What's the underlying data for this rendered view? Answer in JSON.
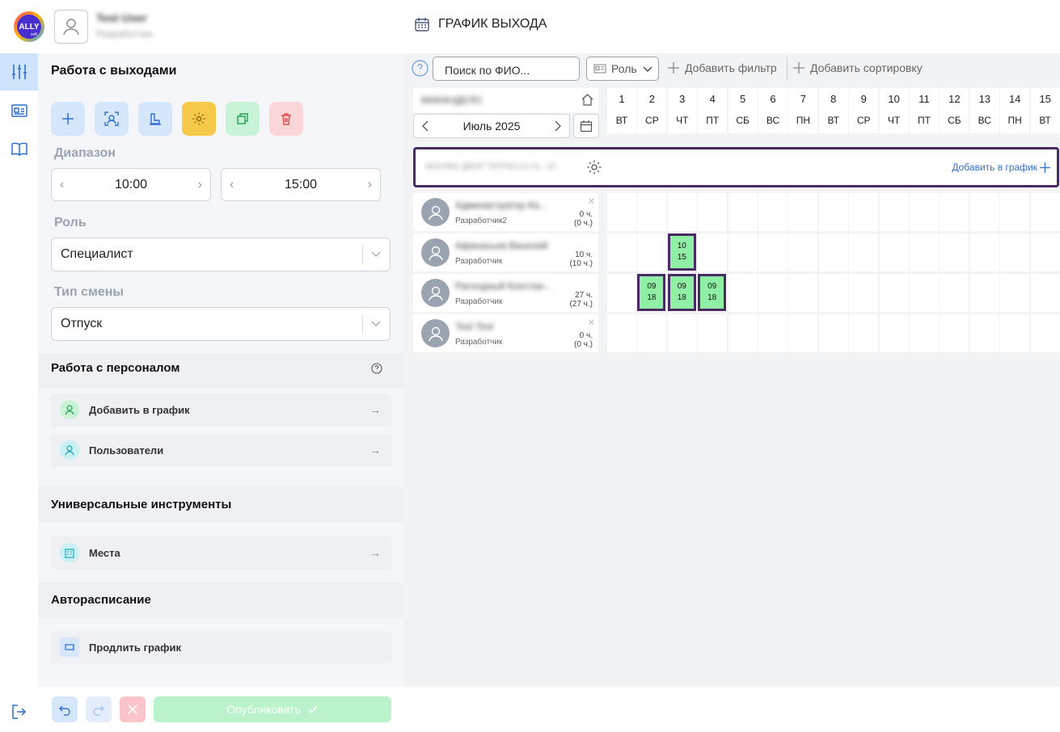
{
  "header": {
    "logo_text": "ALLY",
    "logo_sub": "soft",
    "user_name": "Test User",
    "user_subtitle": "Разработчик",
    "page_title": "ГРАФИК ВЫХОДА"
  },
  "panel": {
    "work_title": "Работа с выходами",
    "range_label": "Диапазон",
    "time_from": "10:00",
    "time_to": "15:00",
    "role_label": "Роль",
    "role_value": "Специалист",
    "shift_type_label": "Тип смены",
    "shift_type_value": "Отпуск",
    "staff_title": "Работа с персоналом",
    "add_to_schedule": "Добавить в график",
    "users": "Пользователи",
    "universal_title": "Универсальные инструменты",
    "places": "Места",
    "auto_title": "Авторасписание",
    "extend": "Продлить график"
  },
  "footer": {
    "publish": "Опубликовать"
  },
  "toolbar": {
    "search_placeholder": "Поиск по ФИО...",
    "role_filter": "Роль",
    "add_filter": "Добавить фильтр",
    "add_sort": "Добавить сортировку"
  },
  "calendar": {
    "company": "МАКАНДЕЛО",
    "month": "Июль 2025",
    "days": [
      {
        "n": "1",
        "w": "ВТ"
      },
      {
        "n": "2",
        "w": "СР"
      },
      {
        "n": "3",
        "w": "ЧТ"
      },
      {
        "n": "4",
        "w": "ПТ"
      },
      {
        "n": "5",
        "w": "СБ"
      },
      {
        "n": "6",
        "w": "ВС"
      },
      {
        "n": "7",
        "w": "ПН"
      },
      {
        "n": "8",
        "w": "ВТ"
      },
      {
        "n": "9",
        "w": "СР"
      },
      {
        "n": "10",
        "w": "ЧТ"
      },
      {
        "n": "11",
        "w": "ПТ"
      },
      {
        "n": "12",
        "w": "СБ"
      },
      {
        "n": "13",
        "w": "ВС"
      },
      {
        "n": "14",
        "w": "ПН"
      },
      {
        "n": "15",
        "w": "ВТ"
      }
    ],
    "group_name": "МОСКВА ДВОР ТЕРРАССА 01...10",
    "group_add": "Добавить в график"
  },
  "employees": [
    {
      "name": "Администратор Ка...",
      "role": "Разработчик2",
      "h1": "0 ч.",
      "h2": "(0 ч.)",
      "removable": true,
      "shifts": []
    },
    {
      "name": "Афанасьев Василий",
      "role": "Разработчик",
      "h1": "10 ч.",
      "h2": "(10 ч.)",
      "removable": false,
      "shifts": [
        {
          "day": 3,
          "start": "10",
          "end": "15"
        }
      ]
    },
    {
      "name": "Расходный Констан...",
      "role": "Разработчик",
      "h1": "27 ч.",
      "h2": "(27 ч.)",
      "removable": false,
      "shifts": [
        {
          "day": 2,
          "start": "09",
          "end": "18"
        },
        {
          "day": 3,
          "start": "09",
          "end": "18"
        },
        {
          "day": 4,
          "start": "09",
          "end": "18"
        }
      ]
    },
    {
      "name": "Test Test",
      "role": "Разработчик",
      "h1": "0 ч.",
      "h2": "(0 ч.)",
      "removable": true,
      "shifts": []
    }
  ],
  "colors": {
    "accent": "#4a2a63",
    "shift_fill": "#8ff0a5",
    "publish": "#b9f2cb",
    "tool_yellow": "#f7c94a"
  }
}
